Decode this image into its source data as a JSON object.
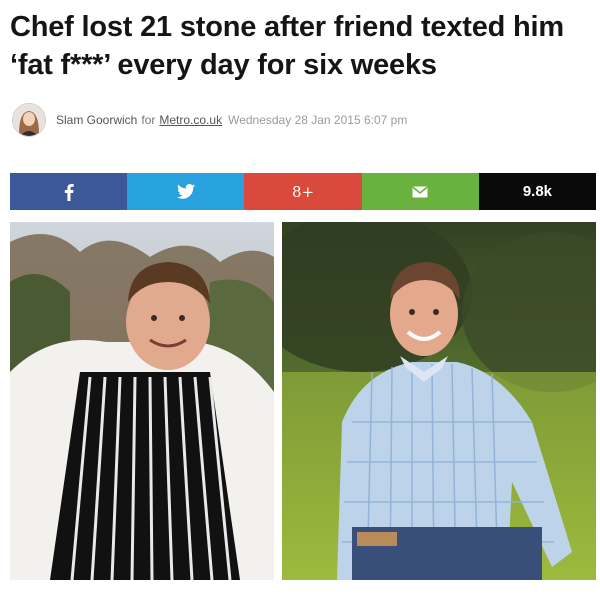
{
  "article": {
    "headline": "Chef lost 21 stone after friend texted him ‘fat f***’ every day for six weeks",
    "author": "Slam Goorwich",
    "for_text": "for",
    "source": "Metro.co.uk",
    "date": "Wednesday 28 Jan 2015 6:07 pm"
  },
  "share": {
    "facebook_icon": "facebook-icon",
    "twitter_icon": "twitter-icon",
    "googleplus_label": "8+",
    "email_icon": "email-icon",
    "count": "9.8k",
    "colors": {
      "facebook": "#3b5998",
      "twitter": "#27a2de",
      "googleplus": "#d9493c",
      "email": "#6ab23f",
      "count": "#0a0a0a"
    }
  }
}
